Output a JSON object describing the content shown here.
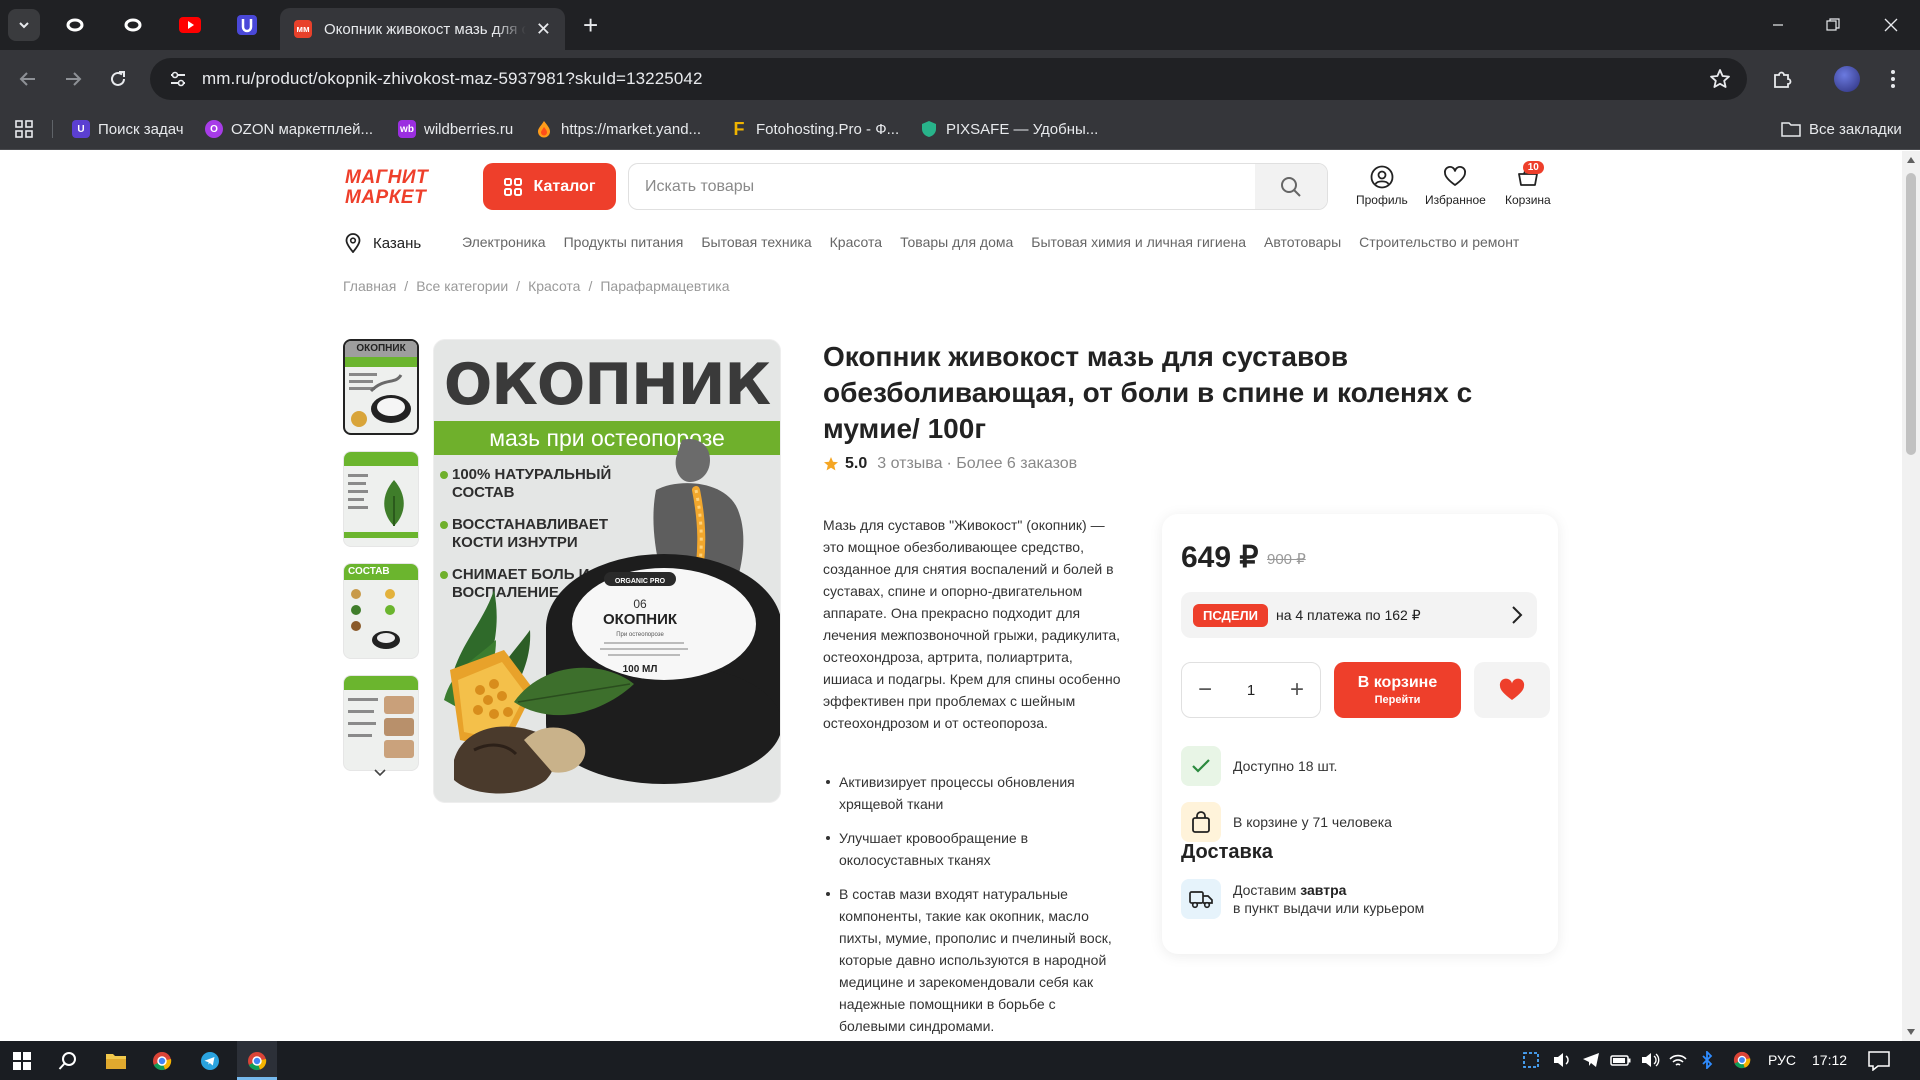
{
  "browser": {
    "tab_title": "Окопник живокост мазь для с",
    "url": "mm.ru/product/okopnik-zhivokost-maz-5937981?skuId=13225042",
    "bookmarks": [
      {
        "label": "Поиск задач",
        "icon": "u-purple-icon",
        "color": "#5b3fd1"
      },
      {
        "label": "OZON маркетплей...",
        "icon": "ozon-icon",
        "color": "#a73ce8"
      },
      {
        "label": "wildberries.ru",
        "icon": "wb-icon",
        "color": "#9b2ee0"
      },
      {
        "label": "https://market.yand...",
        "icon": "flame-icon",
        "color": "#ff9c1a"
      },
      {
        "label": "Fotohosting.Pro - Ф...",
        "icon": "f-letter-icon",
        "color": "#f0b400"
      },
      {
        "label": "PIXSAFE — Удобны...",
        "icon": "shield-icon",
        "color": "#28b38a"
      }
    ],
    "all_bookmarks": "Все закладки"
  },
  "header": {
    "logo_line1": "МАГНИТ",
    "logo_line2": "МАРКЕТ",
    "catalog_label": "Каталог",
    "search_placeholder": "Искать товары",
    "profile_label": "Профиль",
    "favorites_label": "Избранное",
    "cart_label": "Корзина",
    "cart_count": "10",
    "accent_color": "#ee3f2b"
  },
  "nav": {
    "city": "Казань",
    "categories": [
      "Электроника",
      "Продукты питания",
      "Бытовая техника",
      "Красота",
      "Товары для дома",
      "Бытовая химия и личная гигиена",
      "Автотовары",
      "Строительство и ремонт"
    ]
  },
  "breadcrumbs": [
    "Главная",
    "Все категории",
    "Красота",
    "Парафармацевтика"
  ],
  "gallery": {
    "thumb_labels": [
      "ОКОПНИК",
      "",
      "СОСТАВ",
      ""
    ],
    "image": {
      "title": "ОКОПНИК",
      "band": "мазь при остеопорозе",
      "features": [
        "100% НАТУРАЛЬНЫЙ СОСТАВ",
        "ВОССТАНАВЛИВАЕТ КОСТИ ИЗНУТРИ",
        "СНИМАЕТ БОЛЬ И ВОСПАЛЕНИЕ"
      ],
      "jar_brand": "ORGANIC PRO",
      "jar_number": "06",
      "jar_title": "ОКОПНИК",
      "jar_sub": "При остеопорозе",
      "jar_volume": "100 МЛ"
    }
  },
  "product": {
    "title": "Окопник живокост мазь для суставов обезболивающая, от боли в спине и коленях с мумие/ 100г",
    "rating": "5.0",
    "reviews": "3 отзыва",
    "orders": "· Более 6 заказов",
    "description": "Мазь для суставов \"Живокост\" (окопник) — это мощное обезболивающее средство, созданное для снятия воспалений и болей в суставах, спине и опорно-двигательном аппарате. Она прекрасно подходит для лечения межпозвоночной грыжи, радикулита, остеохондроза, артрита, полиартрита, ишиаса и подагры. Крем для спины особенно эффективен при проблемах с шейным остеохондрозом и от остеопороза.",
    "bullets": [
      "Активизирует процессы обновления хрящевой ткани",
      "Улучшает кровообращение в околосуставных тканях",
      "В состав мази входят натуральные компоненты, такие как окопник, масло пихты, мумие, прополис и пчелиный воск, которые давно используются в народной медицине и зарекомендовали себя как надежные помощники в борьбе с болевыми синдромами."
    ]
  },
  "buybox": {
    "price": "649 ₽",
    "old_price": "900 ₽",
    "split_badge": "ПСДЕЛИ",
    "split_text": "на 4 платежа по 162 ₽",
    "quantity": "1",
    "cart_button_line1": "В корзине",
    "cart_button_line2": "Перейти",
    "stock": "Доступно 18 шт.",
    "in_carts": "В корзине у 71 человека",
    "delivery_heading": "Доставка",
    "delivery_prefix": "Доставим ",
    "delivery_when": "завтра",
    "delivery_note": "в пункт выдачи или курьером"
  },
  "taskbar": {
    "language": "РУС",
    "time": "17:12"
  }
}
